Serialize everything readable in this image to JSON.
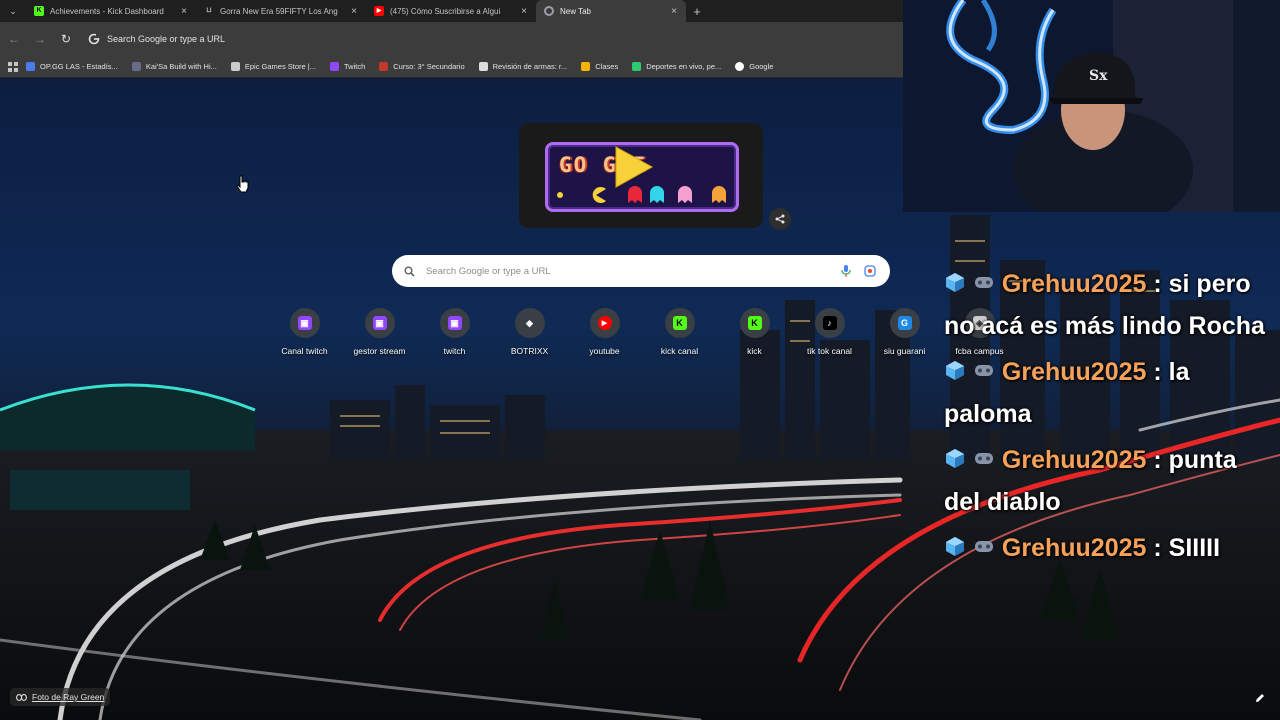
{
  "browser": {
    "tabs": [
      {
        "title": "Achievements - Kick Dashboard",
        "favicon": "kick-icon",
        "color": "#53fc18",
        "active": false
      },
      {
        "title": "Gorra New Era 59FIFTY Los Ang",
        "favicon": "store-icon",
        "color": "#888888",
        "active": false
      },
      {
        "title": "(475) Cómo Suscribirse a Algui",
        "favicon": "youtube-icon",
        "color": "#ff0000",
        "active": false
      },
      {
        "title": "New Tab",
        "favicon": "chrome-icon",
        "color": "#9aa0a6",
        "active": true
      }
    ],
    "omnibox_text": "Search Google or type a URL",
    "bookmarks": [
      {
        "label": "OP.GG LAS - Estadís...",
        "color": "#4b7bec"
      },
      {
        "label": "Kai'Sa Build with Hi...",
        "color": "#6a6a8a"
      },
      {
        "label": "Epic Games Store |...",
        "color": "#cccccc"
      },
      {
        "label": "Twitch",
        "color": "#9146ff"
      },
      {
        "label": "Curso: 3° Secundario",
        "color": "#c0392b"
      },
      {
        "label": "Revisión de armas: r...",
        "color": "#dddddd"
      },
      {
        "label": "Clases",
        "color": "#f4b400"
      },
      {
        "label": "Deportes en vivo, pe...",
        "color": "#2ecc71"
      },
      {
        "label": "Google",
        "color": "#ffffff"
      }
    ]
  },
  "newtab": {
    "doodle_text": "GO  GLE",
    "search_placeholder": "Search Google or type a URL",
    "shortcuts": [
      {
        "label": "Canal twitch",
        "icon": "twitch-icon",
        "color": "#9146ff",
        "glyph": "▣"
      },
      {
        "label": "gestor stream",
        "icon": "twitch-icon",
        "color": "#9146ff",
        "glyph": "▣"
      },
      {
        "label": "twitch",
        "icon": "twitch-icon",
        "color": "#9146ff",
        "glyph": "▣"
      },
      {
        "label": "BOTRIXX",
        "icon": "botrixx-icon",
        "color": "#ffffff",
        "glyph": "◆"
      },
      {
        "label": "youtube",
        "icon": "youtube-icon",
        "color": "#ff0000",
        "glyph": "▶"
      },
      {
        "label": "kick canal",
        "icon": "kick-icon",
        "color": "#53fc18",
        "glyph": "K"
      },
      {
        "label": "kick",
        "icon": "kick-icon",
        "color": "#53fc18",
        "glyph": "K"
      },
      {
        "label": "tik tok canal",
        "icon": "tiktok-icon",
        "color": "#000000",
        "glyph": "♪"
      },
      {
        "label": "siu guarani",
        "icon": "siu-icon",
        "color": "#1e88e5",
        "glyph": "G"
      },
      {
        "label": "fcba campus",
        "icon": "campus-icon",
        "color": "#cccccc",
        "glyph": "◈"
      }
    ],
    "photo_credit": "Foto de Ray Green"
  },
  "chat": {
    "messages": [
      {
        "user": "Grehuu2025",
        "text": " : si pero no acá es más lindo Rocha"
      },
      {
        "user": "Grehuu2025",
        "text": " : la paloma"
      },
      {
        "user": "Grehuu2025",
        "text": " : punta del diablo"
      },
      {
        "user": "Grehuu2025",
        "text": " : SIIIII"
      }
    ]
  }
}
